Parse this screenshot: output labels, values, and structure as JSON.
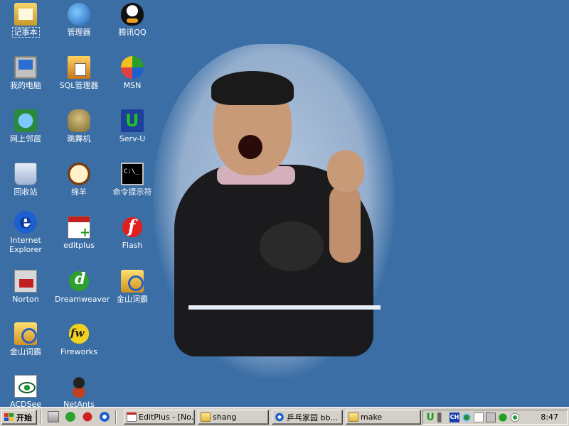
{
  "desktop": {
    "icons": [
      {
        "label": "记事本",
        "glyph": "notepad-icon"
      },
      {
        "label": "管理器",
        "glyph": "manager-icon"
      },
      {
        "label": "腾讯QQ",
        "glyph": "qq-penguin-icon"
      },
      {
        "label": "我的电脑",
        "glyph": "my-computer-icon"
      },
      {
        "label": "SQL管理器",
        "glyph": "sql-manager-icon"
      },
      {
        "label": "MSN",
        "glyph": "msn-butterfly-icon"
      },
      {
        "label": "网上邻居",
        "glyph": "network-places-icon"
      },
      {
        "label": "跳舞机",
        "glyph": "dance-machine-icon"
      },
      {
        "label": "Serv-U",
        "glyph": "serv-u-icon"
      },
      {
        "label": "回收站",
        "glyph": "recycle-bin-icon"
      },
      {
        "label": "绵羊",
        "glyph": "sheep-icon"
      },
      {
        "label": "命令提示符",
        "glyph": "command-prompt-icon"
      },
      {
        "label": "Internet Explorer",
        "glyph": "internet-explorer-icon"
      },
      {
        "label": "editplus",
        "glyph": "editplus-icon"
      },
      {
        "label": "Flash",
        "glyph": "flash-icon"
      },
      {
        "label": "Norton",
        "glyph": "norton-icon"
      },
      {
        "label": "Dreamweaver",
        "glyph": "dreamweaver-icon"
      },
      {
        "label": "金山词霸",
        "glyph": "kingsoft-dictionary-icon"
      },
      {
        "label": "金山词霸",
        "glyph": "kingsoft-dictionary-icon"
      },
      {
        "label": "Fireworks",
        "glyph": "fireworks-icon"
      },
      {
        "label": "ACDSee",
        "glyph": "acdsee-icon"
      },
      {
        "label": "NetAnts",
        "glyph": "netants-icon"
      }
    ],
    "background_color": "#3a6ea5"
  },
  "taskbar": {
    "start_label": "开始",
    "quick_launch": [
      "show-desktop-icon",
      "dreamweaver-icon",
      "red-app-icon",
      "internet-explorer-icon"
    ],
    "tasks": [
      {
        "label": "EditPlus - [No...",
        "icon": "editplus-icon"
      },
      {
        "label": "shang",
        "icon": "folder-icon"
      },
      {
        "label": "乒乓家园 bb...",
        "icon": "internet-explorer-icon"
      },
      {
        "label": "make",
        "icon": "folder-icon"
      }
    ],
    "tray": {
      "ime_label": "CH",
      "serv_u_label": "U",
      "clock": "8:47",
      "icons": [
        "serv-u-tray-icon",
        "speaker-icon",
        "input-method-icon",
        "network-icon",
        "document-icon",
        "computer-icon",
        "green-app-icon",
        "eye-icon"
      ]
    },
    "colors": {
      "face": "#d4d0c8"
    }
  }
}
